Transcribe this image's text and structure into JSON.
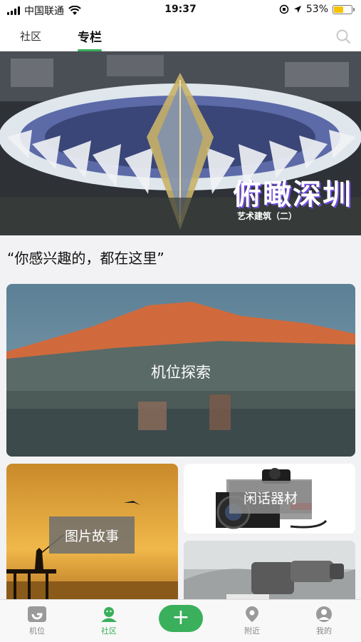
{
  "status_bar": {
    "carrier": "中国联通",
    "time": "19:37",
    "battery_percent_label": "53%",
    "battery_level": 0.53
  },
  "top_nav": {
    "tabs": [
      {
        "label": "社区",
        "active": false
      },
      {
        "label": "专栏",
        "active": true
      }
    ],
    "search_icon": "search-icon"
  },
  "banner": {
    "title": "俯瞰深圳",
    "subtitle": "艺术建筑（二）"
  },
  "slogan": "“你感兴趣的，都在这里”",
  "cards": [
    {
      "label": "机位探索"
    },
    {
      "label": "图片故事"
    },
    {
      "label": "闲话器材"
    }
  ],
  "bottom_tabs": [
    {
      "label": "机位",
      "icon": "camera-spot-icon"
    },
    {
      "label": "社区",
      "icon": "community-icon",
      "active": true
    },
    {
      "label": "",
      "icon": "plus-icon"
    },
    {
      "label": "附近",
      "icon": "location-pin-icon"
    },
    {
      "label": "我的",
      "icon": "profile-icon"
    }
  ],
  "colors": {
    "accent": "#3aaf5c",
    "battery": "#f5c400",
    "banner_title_shadow": "#6f4ae0"
  }
}
